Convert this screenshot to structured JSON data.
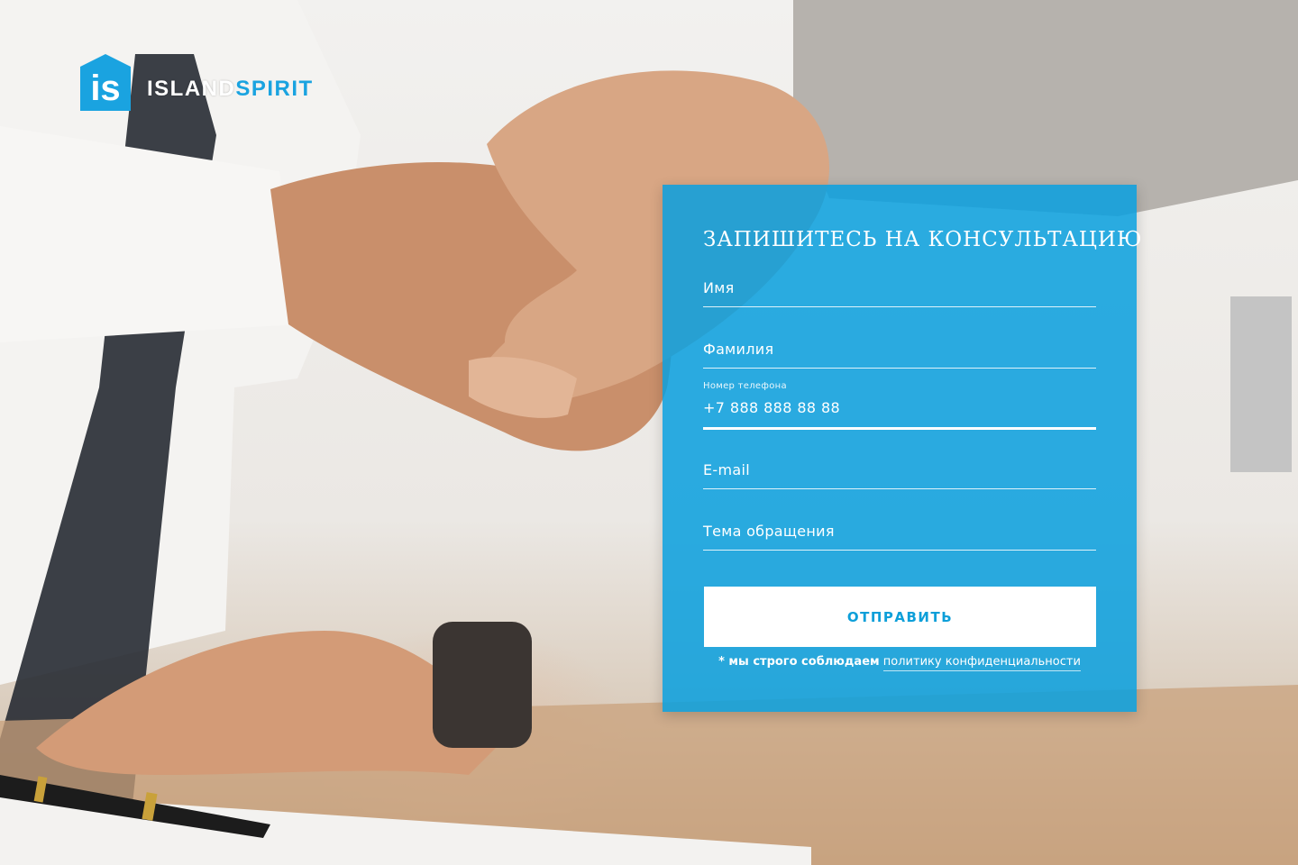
{
  "brand": {
    "logo_mark": "is",
    "name_part1": "ISLAND",
    "name_part2": "SPIRIT",
    "colors": {
      "accent": "#1aa3e0",
      "panel": "#09a0de"
    }
  },
  "form": {
    "title": "ЗАПИШИТЕСЬ НА КОНСУЛЬТАЦИЮ",
    "fields": {
      "first_name": {
        "placeholder": "Имя",
        "value": ""
      },
      "last_name": {
        "placeholder": "Фамилия",
        "value": ""
      },
      "phone": {
        "label": "Номер телефона",
        "value": "+7 888 888 88 88"
      },
      "email": {
        "placeholder": "E-mail",
        "value": ""
      },
      "subject": {
        "placeholder": "Тема обращения",
        "value": ""
      }
    },
    "submit_label": "ОТПРАВИТЬ",
    "privacy_prefix": "* мы строго соблюдаем",
    "privacy_link": "политику конфиденциальности"
  },
  "icons": {
    "logo": "house-logo-icon"
  }
}
